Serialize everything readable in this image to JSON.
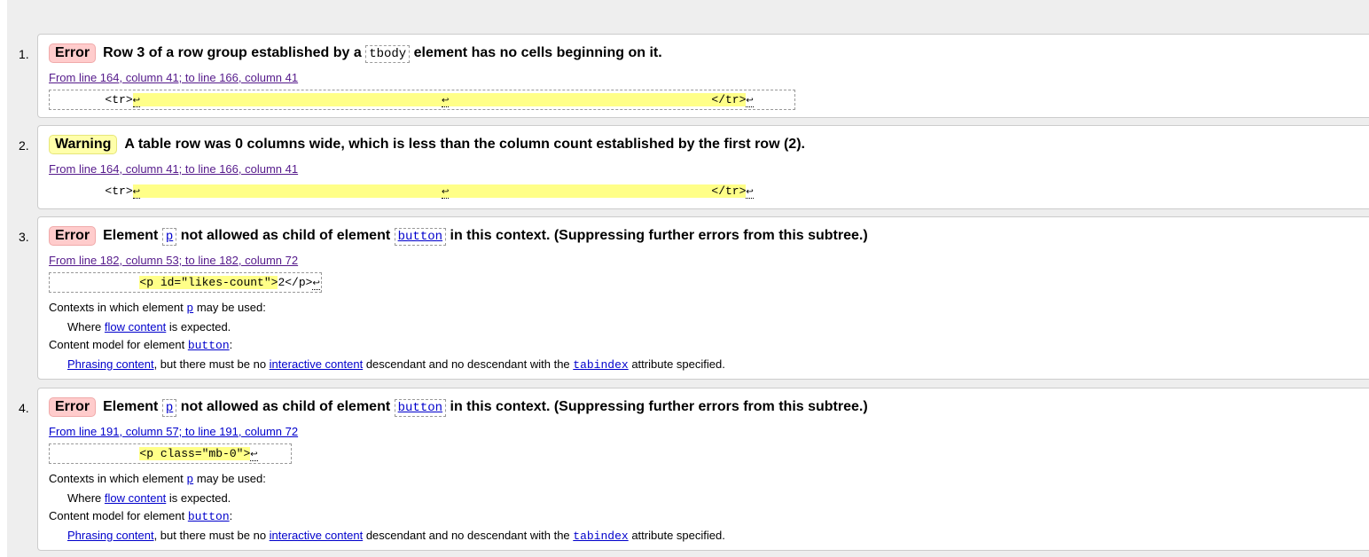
{
  "messages": [
    {
      "num": "1.",
      "type": "Error",
      "pre": "Row 3 of a row group established by a",
      "code": "tbody",
      "post": "element has no cells beginning on it.",
      "location": "From line 164, column 41; to line 166, column 41",
      "extract": {
        "lead": "        <tr>",
        "mid": "                                                                                ",
        "tail": "</tr>"
      }
    },
    {
      "num": "2.",
      "type": "Warning",
      "text": "A table row was 0 columns wide, which is less than the column count established by the first row (2).",
      "location": "From line 164, column 41; to line 166, column 41",
      "extract": {
        "lead": "        <tr>",
        "tail": "</tr>"
      }
    },
    {
      "num": "3.",
      "type": "Error",
      "pre": "Element",
      "code1": "p",
      "mid": "not allowed as child of element",
      "code2": "button",
      "post": "in this context. (Suppressing further errors from this subtree.)",
      "location": "From line 182, column 53; to line 182, column 72",
      "extract": {
        "lead": "             ",
        "hl": "<p id=\"likes-count\">",
        "tail": "2</p>"
      }
    },
    {
      "num": "4.",
      "type": "Error",
      "pre": "Element",
      "code1": "p",
      "mid": "not allowed as child of element",
      "code2": "button",
      "post": "in this context. (Suppressing further errors from this subtree.)",
      "location": "From line 191, column 57; to line 191, column 72",
      "extract": {
        "lead": "             ",
        "hl": "<p class=\"mb-0\">",
        "tail": ""
      }
    }
  ],
  "context": {
    "l1a": "Contexts in which element",
    "p": "p",
    "l1b": "may be used:",
    "l2a": "Where",
    "flow": "flow content",
    "l2b": "is expected.",
    "l3a": "Content model for element",
    "button": "button",
    "l4a": "Phrasing content",
    "l4b": ", but there must be no",
    "interactive": "interactive content",
    "l4c": "descendant and no descendant with the",
    "tabindex": "tabindex",
    "l4d": "attribute specified."
  },
  "colors": {
    "error_badge": "#ffcccc",
    "warning_badge": "#ffffaa",
    "highlight": "#ffff88",
    "link": "#0000cc"
  }
}
